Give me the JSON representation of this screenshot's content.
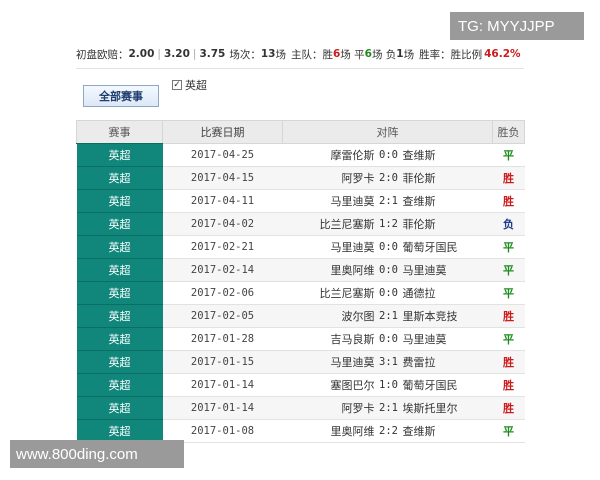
{
  "watermarks": {
    "tg": "TG: MYYJJPP",
    "site": "www.800ding.com"
  },
  "stats": {
    "label_odds": "初盘欧赔：",
    "odd_1": "2.00",
    "odd_2": "3.20",
    "odd_3": "3.75",
    "label_matches": "场次：",
    "matches": "13",
    "unit_chang": "场",
    "label_home": "主队：",
    "win_label": "胜",
    "wins": "6",
    "draw_label": "场 平",
    "draws": "6",
    "loss_label": "场 负",
    "losses": "1",
    "tail": "场",
    "label_rate": "胜率：胜比例",
    "win_rate": "46.2%",
    "cut": "平"
  },
  "filter": {
    "all_button": "全部赛事",
    "league_check": "✓",
    "league": "英超"
  },
  "table": {
    "headers": [
      "赛事",
      "比赛日期",
      "对阵",
      "胜负"
    ],
    "rows": [
      {
        "league": "英超",
        "date": "2017-04-25",
        "home": "摩雷伦斯",
        "score": "0:0",
        "away": "查维斯",
        "result": "平",
        "type": "draw"
      },
      {
        "league": "英超",
        "date": "2017-04-15",
        "home": "阿罗卡",
        "score": "2:0",
        "away": "菲伦斯",
        "result": "胜",
        "type": "win"
      },
      {
        "league": "英超",
        "date": "2017-04-11",
        "home": "马里迪莫",
        "score": "2:1",
        "away": "查维斯",
        "result": "胜",
        "type": "win"
      },
      {
        "league": "英超",
        "date": "2017-04-02",
        "home": "比兰尼塞斯",
        "score": "1:2",
        "away": "菲伦斯",
        "result": "负",
        "type": "loss"
      },
      {
        "league": "英超",
        "date": "2017-02-21",
        "home": "马里迪莫",
        "score": "0:0",
        "away": "葡萄牙国民",
        "result": "平",
        "type": "draw"
      },
      {
        "league": "英超",
        "date": "2017-02-14",
        "home": "里奥阿维",
        "score": "0:0",
        "away": "马里迪莫",
        "result": "平",
        "type": "draw"
      },
      {
        "league": "英超",
        "date": "2017-02-06",
        "home": "比兰尼塞斯",
        "score": "0:0",
        "away": "通德拉",
        "result": "平",
        "type": "draw"
      },
      {
        "league": "英超",
        "date": "2017-02-05",
        "home": "波尔图",
        "score": "2:1",
        "away": "里斯本竞技",
        "result": "胜",
        "type": "win"
      },
      {
        "league": "英超",
        "date": "2017-01-28",
        "home": "吉马良斯",
        "score": "0:0",
        "away": "马里迪莫",
        "result": "平",
        "type": "draw"
      },
      {
        "league": "英超",
        "date": "2017-01-15",
        "home": "马里迪莫",
        "score": "3:1",
        "away": "费雷拉",
        "result": "胜",
        "type": "win"
      },
      {
        "league": "英超",
        "date": "2017-01-14",
        "home": "塞图巴尔",
        "score": "1:0",
        "away": "葡萄牙国民",
        "result": "胜",
        "type": "win"
      },
      {
        "league": "英超",
        "date": "2017-01-14",
        "home": "阿罗卡",
        "score": "2:1",
        "away": "埃斯托里尔",
        "result": "胜",
        "type": "win"
      },
      {
        "league": "英超",
        "date": "2017-01-08",
        "home": "里奥阿维",
        "score": "2:2",
        "away": "查维斯",
        "result": "平",
        "type": "draw"
      }
    ]
  }
}
